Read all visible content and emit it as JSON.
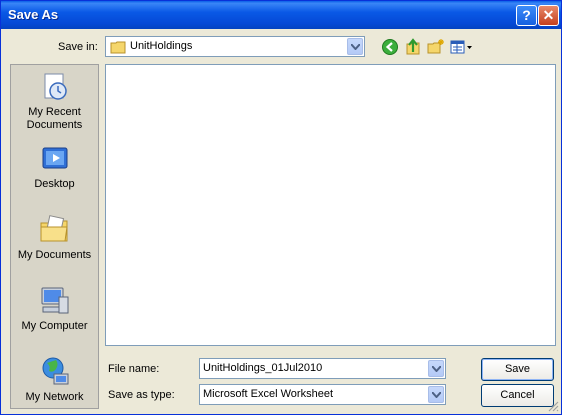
{
  "window": {
    "title": "Save As",
    "help_glyph": "?",
    "close_glyph": "✕"
  },
  "save_in": {
    "label": "Save in:",
    "value": "UnitHoldings"
  },
  "toolbar": {
    "back_icon": "back-icon",
    "up_icon": "up-folder-icon",
    "new_folder_icon": "new-folder-icon",
    "views_icon": "views-menu-icon"
  },
  "places": [
    {
      "label_line1": "My Recent",
      "label_line2": "Documents",
      "icon": "recent-documents-icon"
    },
    {
      "label_line1": "Desktop",
      "label_line2": "",
      "icon": "desktop-icon"
    },
    {
      "label_line1": "My Documents",
      "label_line2": "",
      "icon": "my-documents-icon"
    },
    {
      "label_line1": "My Computer",
      "label_line2": "",
      "icon": "my-computer-icon"
    },
    {
      "label_line1": "My Network",
      "label_line2": "",
      "icon": "my-network-icon"
    }
  ],
  "file_name": {
    "label": "File name:",
    "value": "UnitHoldings_01Jul2010"
  },
  "save_as_type": {
    "label": "Save as type:",
    "value": "Microsoft Excel Worksheet"
  },
  "buttons": {
    "save": "Save",
    "cancel": "Cancel"
  },
  "colors": {
    "titlebar": "#0a59e6",
    "dialog_bg": "#ece9d8",
    "places_bg": "#d8d5c8"
  }
}
